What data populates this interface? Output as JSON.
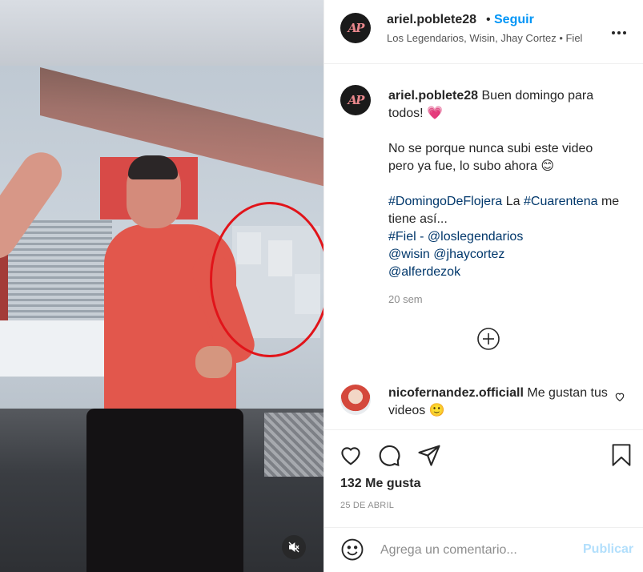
{
  "video": {
    "mute_icon": "speaker-muted-icon"
  },
  "header": {
    "username": "ariel.poblete28",
    "separator": "•",
    "follow_label": "Seguir",
    "subtitle": "Los Legendarios, Wisin, Jhay Cortez • Fiel",
    "avatar_text": "AP",
    "more_icon": "more-options-icon"
  },
  "caption": {
    "username": "ariel.poblete28",
    "line1": "Buen domingo para todos! 💗",
    "line2": "No se porque nunca subi este video pero ya fue, lo subo ahora 😊",
    "hashtag1": "#DomingoDeFlojera",
    "text_la": " La ",
    "hashtag2": "#Cuarentena",
    "text_tiene": " me tiene así...",
    "hashtag3": "#Fiel",
    "text_dash": " - ",
    "mention1": "@loslegendarios",
    "mention2": "@wisin",
    "mention3": "@jhaycortez",
    "mention4": "@alferdezok",
    "time_ago": "20 sem"
  },
  "comment": {
    "username": "nicofernandez.officiall",
    "text": "Me gustan tus videos 🙂"
  },
  "actions": {
    "likes": "132 Me gusta",
    "date": "25 DE ABRIL"
  },
  "comment_box": {
    "placeholder": "Agrega un comentario...",
    "publish_label": "Publicar"
  },
  "colors": {
    "link_blue": "#0095f6",
    "hashtag": "#00376b",
    "publish_disabled": "#b2dffc",
    "red_circle": "#e1141a"
  }
}
